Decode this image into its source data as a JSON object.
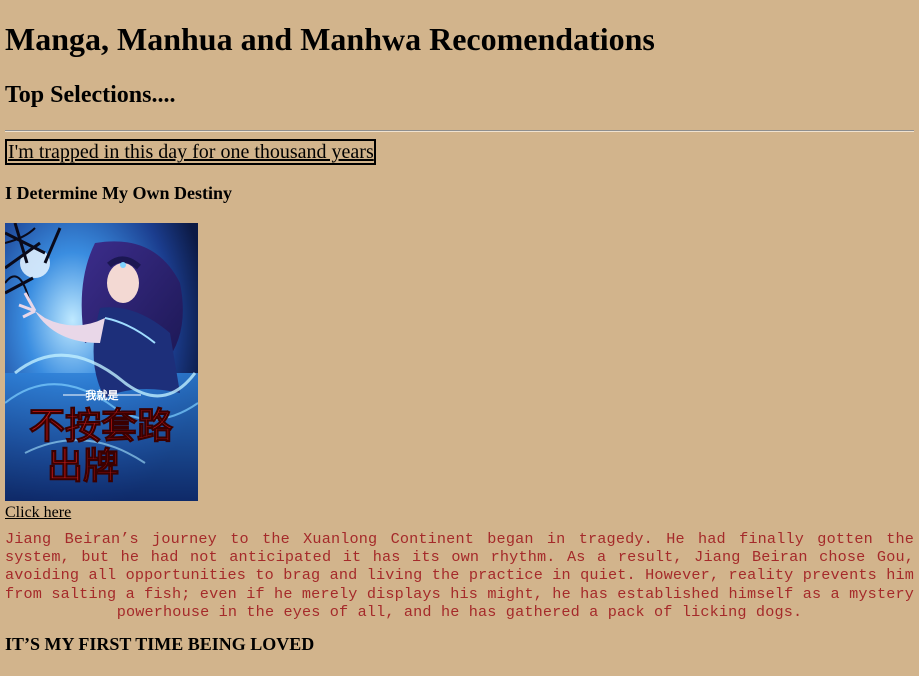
{
  "page": {
    "title": "Manga, Manhua and Manhwa Recomendations",
    "subtitle": "Top Selections....",
    "featured_link": "I'm trapped in this day for one thousand years",
    "colors": {
      "background": "#d2b48c",
      "description_text": "#a52a2a",
      "text": "#000000"
    }
  },
  "entries": [
    {
      "title": "I Determine My Own Destiny",
      "cover_icon": "manhua-cover-image",
      "cover_text": {
        "small": "我就是",
        "line1": "不按套路",
        "line2": "出牌"
      },
      "link_label": "Click here",
      "description": "Jiang Beiran’s journey to the Xuanlong Continent began in tragedy. He had finally gotten the system, but he had not anticipated it has its own rhythm. As a result, Jiang Beiran chose Gou, avoiding all opportunities to brag and living the practice in quiet. However, reality prevents him from salting a fish; even if he merely displays his might, he has established himself as a mystery powerhouse in the eyes of all, and he has gathered a pack of licking dogs."
    },
    {
      "title": "IT’S MY FIRST TIME BEING LOVED"
    }
  ]
}
